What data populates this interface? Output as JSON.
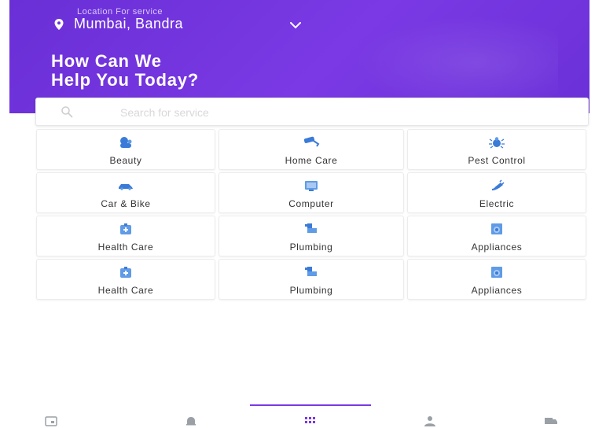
{
  "header": {
    "location_caption": "Location For service",
    "location_value": "Mumbai, Bandra",
    "headline_line1": "How Can We",
    "headline_line2": "Help You Today?",
    "accent": "#7a39e4"
  },
  "search": {
    "placeholder": "Search for service",
    "value": ""
  },
  "services": [
    {
      "label": "Beauty",
      "icon": "beauty-icon",
      "color": "#3b7bd8"
    },
    {
      "label": "Home Care",
      "icon": "paint-roller-icon",
      "color": "#3b7bd8"
    },
    {
      "label": "Pest Control",
      "icon": "bug-icon",
      "color": "#3b7bd8"
    },
    {
      "label": "Car & Bike",
      "icon": "car-icon",
      "color": "#3b7bd8"
    },
    {
      "label": "Computer",
      "icon": "computer-icon",
      "color": "#5f9be6"
    },
    {
      "label": "Electric",
      "icon": "plug-icon",
      "color": "#3b7bd8"
    },
    {
      "label": "Health Care",
      "icon": "medical-kit-icon",
      "color": "#5f9be6"
    },
    {
      "label": "Plumbing",
      "icon": "faucet-icon",
      "color": "#3b7bd8"
    },
    {
      "label": "Appliances",
      "icon": "washing-machine-icon",
      "color": "#5f9be6"
    },
    {
      "label": "Health Care",
      "icon": "medical-kit-icon",
      "color": "#5f9be6"
    },
    {
      "label": "Plumbing",
      "icon": "faucet-icon",
      "color": "#3b7bd8"
    },
    {
      "label": "Appliances",
      "icon": "washing-machine-icon",
      "color": "#5f9be6"
    }
  ],
  "bottom_nav": {
    "items": [
      {
        "icon": "calendar-icon",
        "active": false
      },
      {
        "icon": "bell-icon",
        "active": false
      },
      {
        "icon": "grid-icon",
        "active": true
      },
      {
        "icon": "user-icon",
        "active": false
      },
      {
        "icon": "truck-icon",
        "active": false
      }
    ]
  }
}
